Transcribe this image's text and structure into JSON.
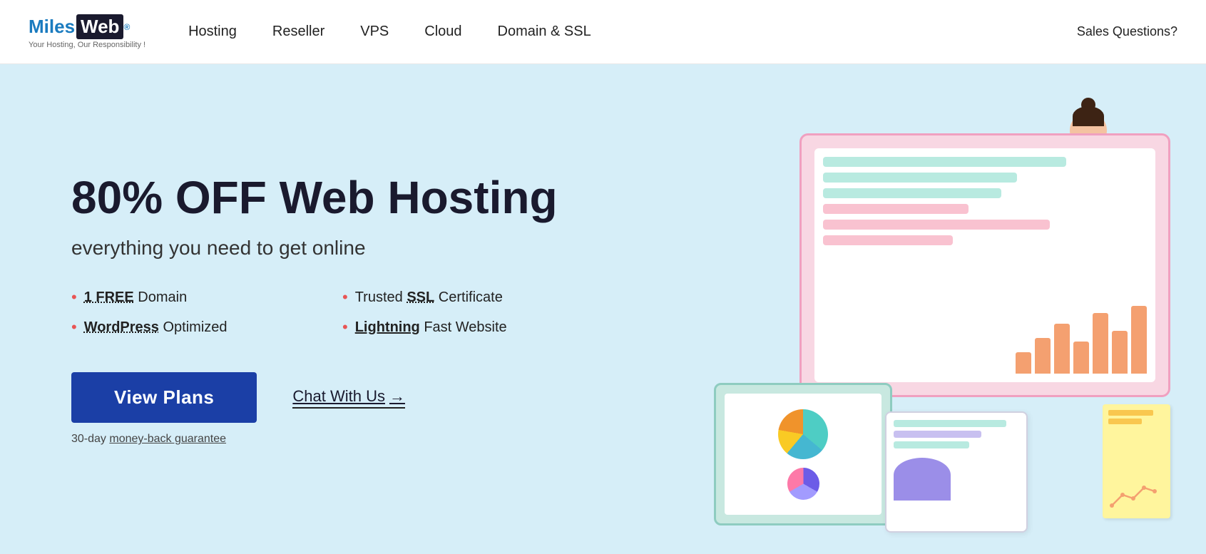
{
  "header": {
    "logo": {
      "miles": "Miles",
      "web": "Web",
      "trademark": "®",
      "tagline": "Your Hosting, Our Responsibility !"
    },
    "nav": {
      "items": [
        {
          "label": "Hosting",
          "id": "hosting"
        },
        {
          "label": "Reseller",
          "id": "reseller"
        },
        {
          "label": "VPS",
          "id": "vps"
        },
        {
          "label": "Cloud",
          "id": "cloud"
        },
        {
          "label": "Domain & SSL",
          "id": "domain-ssl"
        }
      ]
    },
    "sales": "Sales Questions?"
  },
  "hero": {
    "title": "80% OFF Web Hosting",
    "subtitle": "everything you need to get online",
    "features": [
      {
        "bold": "1 FREE",
        "rest": " Domain",
        "col": 0
      },
      {
        "bold": "Trusted SSL",
        "rest": " Certificate",
        "col": 1
      },
      {
        "bold": "WordPress",
        "rest": " Optimized",
        "col": 0
      },
      {
        "bold": "Lightning",
        "rest": " Fast Website",
        "col": 1
      }
    ],
    "cta": {
      "view_plans": "View Plans",
      "chat_label": "Chat With Us",
      "chat_arrow": "→"
    },
    "guarantee": {
      "prefix": "30-day ",
      "link": "money-back guarantee"
    }
  },
  "illustration": {
    "chart_bars": [
      30,
      50,
      70,
      45,
      85,
      60,
      95
    ]
  }
}
